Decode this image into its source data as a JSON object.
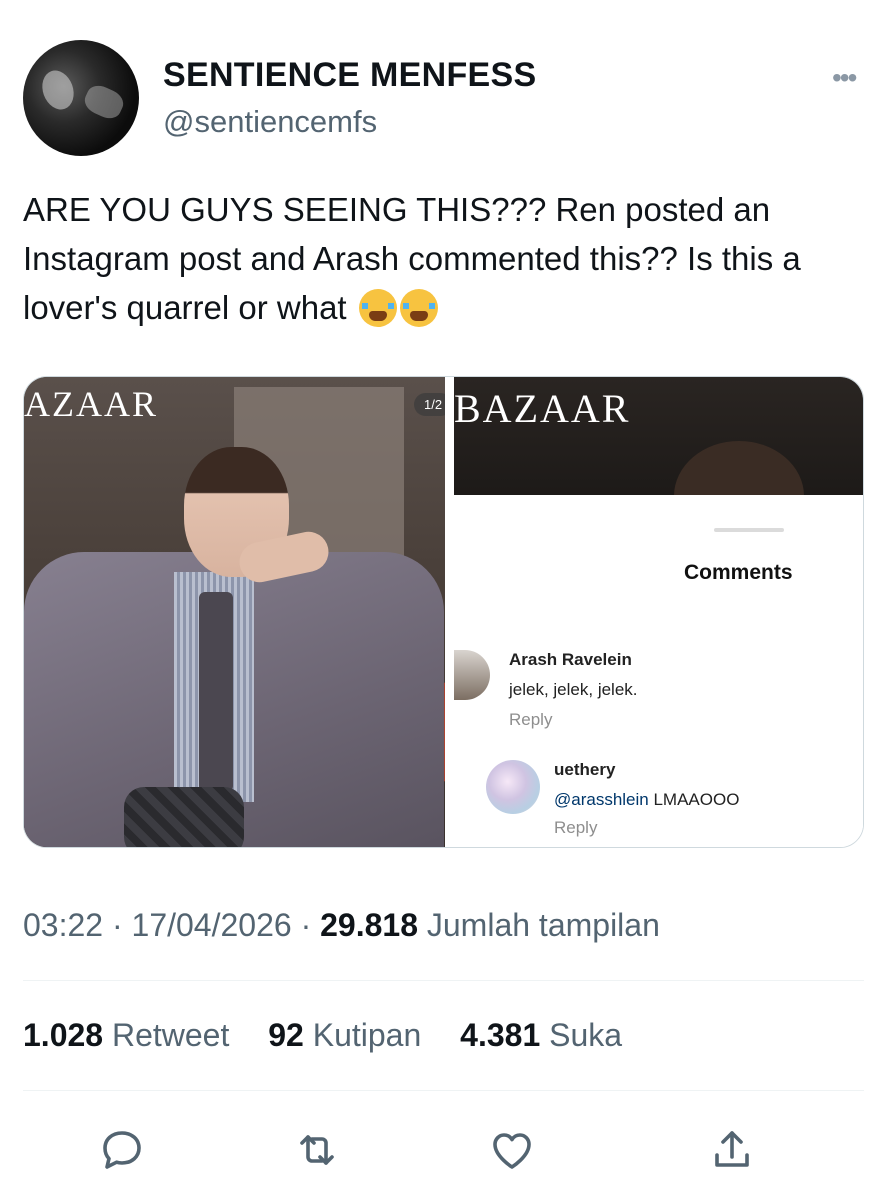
{
  "account": {
    "display_name": "SENTIENCE MENFESS",
    "handle": "@sentiencemfs",
    "more_icon": "more-dots-icon"
  },
  "tweet": {
    "text": "ARE YOU GUYS SEEING THIS??? Ren posted an Instagram post and Arash commented this?? Is this a lover's quarrel or what"
  },
  "media": {
    "left_logo": "AZAAR",
    "pager": "1/2",
    "right_logo": "BAZAAR",
    "comments": {
      "title": "Comments",
      "items": [
        {
          "user": "Arash Ravelein",
          "text": "jelek, jelek, jelek.",
          "reply": "Reply"
        },
        {
          "user": "uethery",
          "mention": "@arasshlein",
          "text": " LMAAOOO",
          "reply": "Reply"
        }
      ]
    }
  },
  "meta": {
    "time": "03:22",
    "date": "17/04/2026",
    "views_count": "29.818",
    "views_label": "Jumlah tampilan"
  },
  "stats": {
    "retweets": "1.028",
    "retweets_label": "Retweet",
    "quotes": "92",
    "quotes_label": "Kutipan",
    "likes": "4.381",
    "likes_label": "Suka"
  },
  "actions": [
    "reply-icon",
    "retweet-icon",
    "like-icon",
    "share-icon"
  ],
  "colors": {
    "secondary_text": "#536471",
    "icon": "#536471",
    "mention": "#00376b"
  }
}
